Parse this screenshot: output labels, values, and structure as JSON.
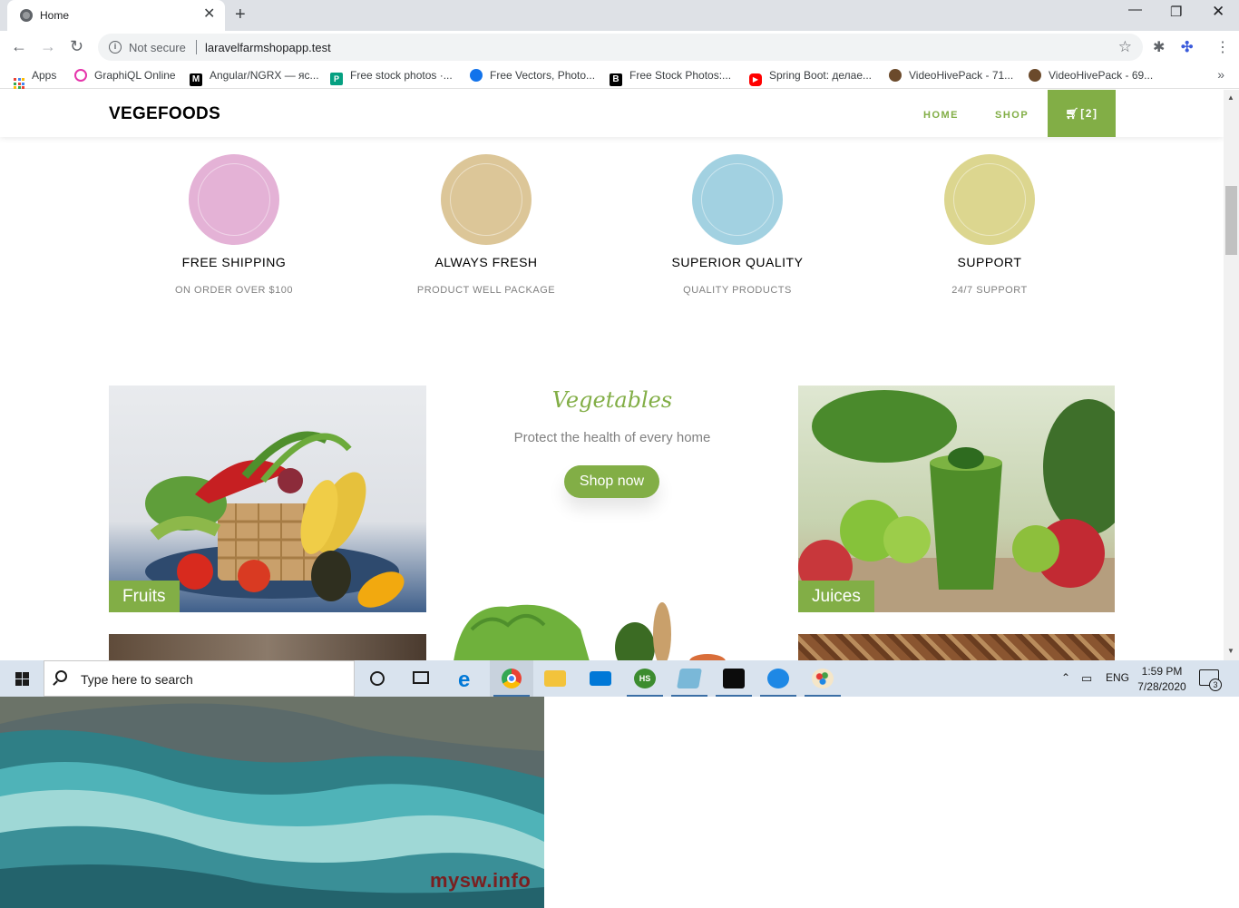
{
  "browser": {
    "tab_title": "Home",
    "security_label": "Not secure",
    "url": "laravelfarmshopapp.test",
    "bookmarks": [
      {
        "label": "Apps",
        "icon": "apps-grid-icon"
      },
      {
        "label": "GraphiQL Online",
        "icon": "graphql-icon",
        "color": "#e535ab"
      },
      {
        "label": "Angular/NGRX — яс...",
        "icon": "medium-icon",
        "color": "#000000"
      },
      {
        "label": "Free stock photos ·...",
        "icon": "pexels-icon",
        "color": "#05a081"
      },
      {
        "label": "Free Vectors, Photo...",
        "icon": "freepik-icon",
        "color": "#1273eb"
      },
      {
        "label": "Free Stock Photos:...",
        "icon": "burst-icon",
        "color": "#000000"
      },
      {
        "label": "Spring Boot: делае...",
        "icon": "youtube-icon",
        "color": "#ff0000"
      },
      {
        "label": "VideoHivePack - 71...",
        "icon": "videohive-icon",
        "color": "#6b4a2b"
      },
      {
        "label": "VideoHivePack - 69...",
        "icon": "videohive-icon",
        "color": "#6b4a2b"
      }
    ]
  },
  "site": {
    "brand": "VEGEFOODS",
    "nav": {
      "home": "HOME",
      "shop": "SHOP",
      "cart": "[2]"
    },
    "accent_color": "#82ae46",
    "services": [
      {
        "title": "FREE SHIPPING",
        "subtitle": "ON ORDER OVER $100",
        "color": "#e4b2d6"
      },
      {
        "title": "ALWAYS FRESH",
        "subtitle": "PRODUCT WELL PACKAGE",
        "color": "#dcc698"
      },
      {
        "title": "SUPERIOR QUALITY",
        "subtitle": "QUALITY PRODUCTS",
        "color": "#a2d1e1"
      },
      {
        "title": "SUPPORT",
        "subtitle": "24/7 SUPPORT",
        "color": "#dcd68f"
      }
    ],
    "categories": {
      "fruits_label": "Fruits",
      "juices_label": "Juices",
      "feature_title": "Vegetables",
      "feature_subtitle": "Protect the health of every home",
      "cta": "Shop now"
    }
  },
  "taskbar": {
    "search_placeholder": "Type here to search",
    "language": "ENG",
    "time": "1:59 PM",
    "date": "7/28/2020",
    "notification_count": "3"
  },
  "desktop": {
    "watermark": "mysw.info"
  }
}
